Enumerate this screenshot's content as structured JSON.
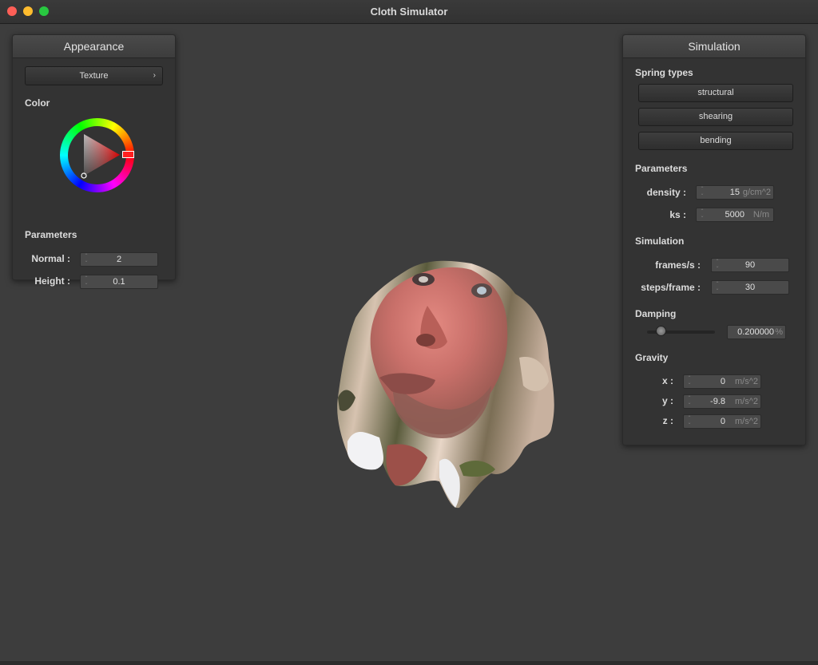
{
  "window": {
    "title": "Cloth Simulator"
  },
  "appearance": {
    "header": "Appearance",
    "texture_button": "Texture",
    "color_label": "Color",
    "params_label": "Parameters",
    "normal_label": "Normal :",
    "normal_value": "2",
    "height_label": "Height :",
    "height_value": "0.1"
  },
  "simulation": {
    "header": "Simulation",
    "spring_types_label": "Spring types",
    "spring_buttons": [
      "structural",
      "shearing",
      "bending"
    ],
    "params_label": "Parameters",
    "density_label": "density :",
    "density_value": "15",
    "density_unit": "g/cm^2",
    "ks_label": "ks :",
    "ks_value": "5000",
    "ks_unit": "N/m",
    "sim_label": "Simulation",
    "fps_label": "frames/s :",
    "fps_value": "90",
    "steps_label": "steps/frame :",
    "steps_value": "30",
    "damping_label": "Damping",
    "damping_value": "0.200000",
    "damping_unit": "%",
    "damping_fraction": 0.2,
    "gravity_label": "Gravity",
    "gx_label": "x :",
    "gx_value": "0",
    "gy_label": "y :",
    "gy_value": "-9.8",
    "gz_label": "z :",
    "gz_value": "0",
    "g_unit": "m/s^2"
  },
  "icons": {
    "chevron": "chevron-right-icon",
    "spinner": "spinner-arrows-icon"
  },
  "colors": {
    "accent_red": "#ff0000",
    "panel_bg": "#333333"
  }
}
